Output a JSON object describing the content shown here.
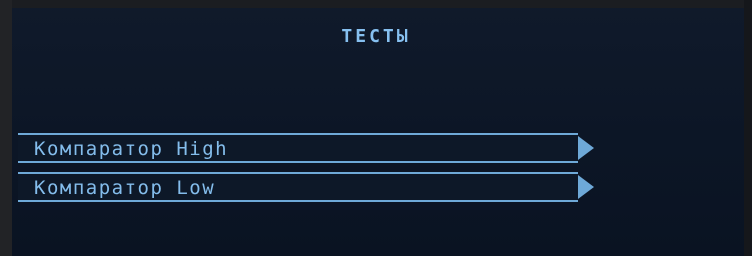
{
  "screen": {
    "title": "ТЕСТЫ"
  },
  "menu": {
    "items": [
      {
        "label": "Компаратор High"
      },
      {
        "label": "Компаратор Low"
      }
    ]
  },
  "colors": {
    "background": "#0c1626",
    "accent": "#6ea9d8",
    "text": "#84bdec"
  },
  "icons": {
    "submenu_arrow": "chevron-right-icon"
  }
}
